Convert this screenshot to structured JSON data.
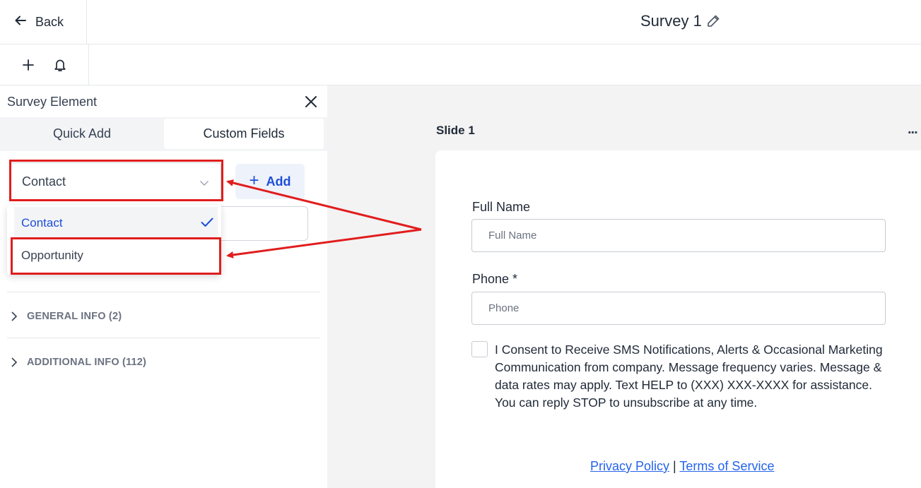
{
  "header": {
    "back_label": "Back",
    "title": "Survey 1"
  },
  "toolbar": {
    "icons": [
      "plus-icon",
      "bell-icon"
    ]
  },
  "panel": {
    "title": "Survey Element",
    "tabs": [
      {
        "label": "Quick Add",
        "active": false
      },
      {
        "label": "Custom Fields",
        "active": true
      }
    ],
    "object_select": {
      "selected": "Contact",
      "options": [
        {
          "label": "Contact",
          "selected": true
        },
        {
          "label": "Opportunity",
          "selected": false
        }
      ]
    },
    "add_label": "Add",
    "groups": [
      {
        "label": "GENERAL INFO (2)"
      },
      {
        "label": "ADDITIONAL INFO (112)"
      }
    ]
  },
  "slide": {
    "title": "Slide 1",
    "menu": "...",
    "fields": [
      {
        "label": "Full Name",
        "placeholder": "Full Name"
      },
      {
        "label": "Phone *",
        "placeholder": "Phone"
      }
    ],
    "consent_text": "I Consent to Receive SMS Notifications, Alerts & Occasional Marketing Communication from company. Message frequency varies. Message & data rates may apply. Text HELP to (XXX) XXX-XXXX for assistance. You can reply STOP to unsubscribe at any time.",
    "links": {
      "privacy": "Privacy Policy",
      "separator": "|",
      "terms": "Terms of Service"
    }
  },
  "colors": {
    "accent": "#1d4ed8",
    "annotation": "#e11d1d"
  }
}
